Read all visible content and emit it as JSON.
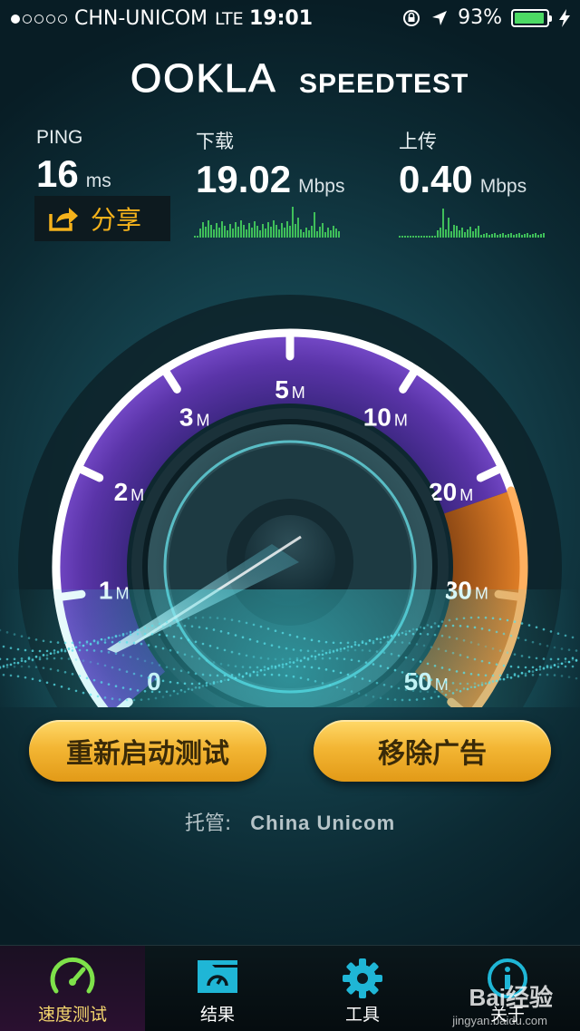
{
  "status_bar": {
    "carrier": "CHN-UNICOM",
    "network": "LTE",
    "time": "19:01",
    "battery": "93%",
    "battery_level": 0.93,
    "signal_dots_filled": 1,
    "signal_dots_total": 5
  },
  "header": {
    "logo": "OOKLA",
    "app_name": "SPEEDTEST"
  },
  "metrics": {
    "ping": {
      "label": "PING",
      "value": "16",
      "unit": "ms"
    },
    "download": {
      "label": "下载",
      "value": "19.02",
      "unit": "Mbps"
    },
    "upload": {
      "label": "上传",
      "value": "0.40",
      "unit": "Mbps"
    }
  },
  "share": {
    "label": "分享"
  },
  "gauge": {
    "ticks": [
      "0",
      "1",
      "2",
      "3",
      "5",
      "10",
      "20",
      "30",
      "50"
    ],
    "tick_unit": "M",
    "needle_value": "0",
    "colors": {
      "ring": "#ffffff",
      "purple": "#6a3fb5",
      "orange": "#f08a2a"
    }
  },
  "buttons": {
    "restart": "重新启动测试",
    "remove_ads": "移除广告"
  },
  "host": {
    "label": "托管:",
    "name": "China Unicom"
  },
  "tabs": [
    {
      "label": "速度测试",
      "icon": "speedometer-icon",
      "active": true
    },
    {
      "label": "结果",
      "icon": "folder-gauge-icon",
      "active": false
    },
    {
      "label": "工具",
      "icon": "gear-icon",
      "active": false
    },
    {
      "label": "关于",
      "icon": "info-icon",
      "active": false
    }
  ],
  "watermark": {
    "brand": "Bai经验",
    "url": "jingyan.baidu.com"
  }
}
